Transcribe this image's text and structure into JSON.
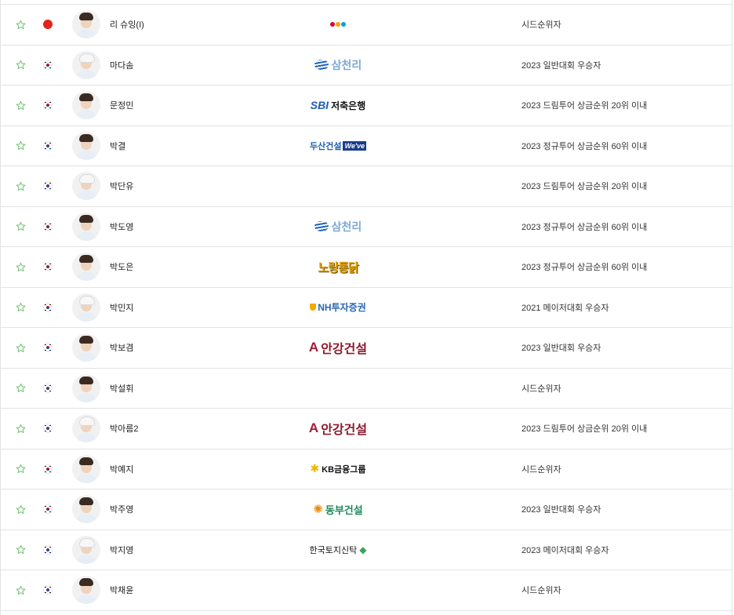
{
  "players": [
    {
      "name": "리 슈잉(I)",
      "flag": "cn",
      "sponsor": "cj",
      "qualification": "시드순위자"
    },
    {
      "name": "마다솜",
      "flag": "kr",
      "sponsor": "samchully",
      "qualification": "2023 일반대회 우승자"
    },
    {
      "name": "문정민",
      "flag": "kr",
      "sponsor": "sbi",
      "qualification": "2023 드림투어 상금순위 20위 이내"
    },
    {
      "name": "박결",
      "flag": "kr",
      "sponsor": "doosan",
      "qualification": "2023 정규투어 상금순위 60위 이내"
    },
    {
      "name": "박단유",
      "flag": "kr",
      "sponsor": "",
      "qualification": "2023 드림투어 상금순위 20위 이내"
    },
    {
      "name": "박도영",
      "flag": "kr",
      "sponsor": "samchully",
      "qualification": "2023 정규투어 상금순위 60위 이내"
    },
    {
      "name": "박도은",
      "flag": "kr",
      "sponsor": "nojang",
      "qualification": "2023 정규투어 상금순위 60위 이내"
    },
    {
      "name": "박민지",
      "flag": "kr",
      "sponsor": "nh",
      "qualification": "2021 메이저대회 우승자"
    },
    {
      "name": "박보겸",
      "flag": "kr",
      "sponsor": "angang",
      "qualification": "2023 일반대회 우승자"
    },
    {
      "name": "박설휘",
      "flag": "kr",
      "sponsor": "",
      "qualification": "시드순위자"
    },
    {
      "name": "박아름2",
      "flag": "kr",
      "sponsor": "angang",
      "qualification": "2023 드림투어 상금순위 20위 이내"
    },
    {
      "name": "박예지",
      "flag": "kr",
      "sponsor": "kb",
      "qualification": "시드순위자"
    },
    {
      "name": "박주영",
      "flag": "kr",
      "sponsor": "dongbu",
      "qualification": "2023 일반대회 우승자"
    },
    {
      "name": "박지영",
      "flag": "kr",
      "sponsor": "lt",
      "qualification": "2023 메이저대회 우승자"
    },
    {
      "name": "박채윤",
      "flag": "kr",
      "sponsor": "",
      "qualification": "시드순위자"
    }
  ],
  "sponsor_texts": {
    "samchully": "삼천리",
    "sbi_brand": "SBI",
    "sbi_rest": "저축은행",
    "doosan_kr": "두산건설",
    "doosan_we": "We've",
    "nojang": "노랑통닭",
    "nh": "NH투자증권",
    "angang_a": "A",
    "angang": "안강건설",
    "kb": "KB금융그룹",
    "dongbu": "동부건설",
    "lt": "한국토지신탁"
  },
  "colors": {
    "star": "#7bc67b",
    "border": "#e3e3e3",
    "text": "#222222"
  },
  "icons": {
    "favorite": "star-outline-icon",
    "flag": "flag-icon"
  }
}
